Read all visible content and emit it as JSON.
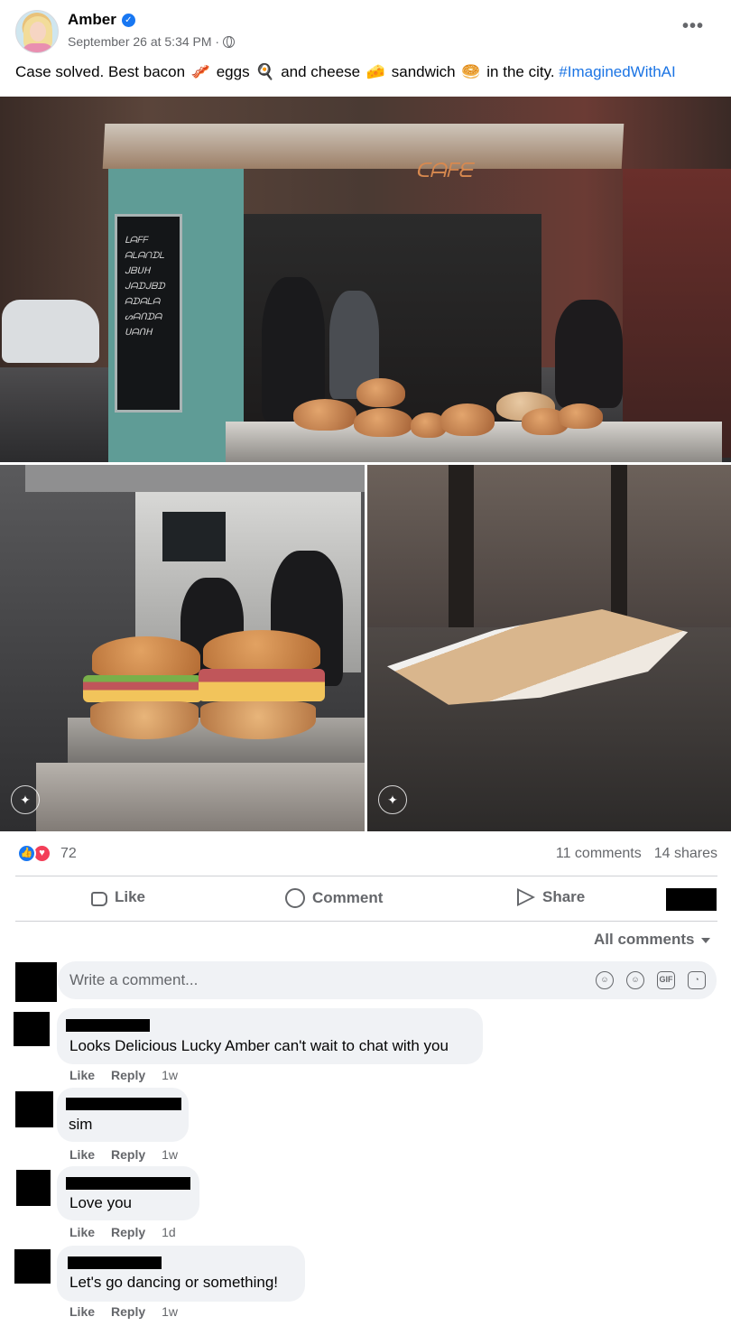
{
  "post": {
    "author": "Amber",
    "timestamp": "September 26 at 5:34 PM ·",
    "caption_parts": {
      "t1": "Case solved. Best bacon",
      "e1": "🥓",
      "t2": "eggs",
      "e2": "🍳",
      "t3": "and cheese",
      "e3": "🧀",
      "t4": "sandwich",
      "e4": "🥯",
      "t5": "in the city.",
      "hashtag": "#ImaginedWithAI"
    }
  },
  "photos": {
    "board_text": [
      "ᒪᗩᖴᖴ",
      "ᗩᒪᗩᑎᗪᒪ",
      "ᒍᗷᑌᕼ",
      "ᒍᗩᗪᒍᗷᗪ",
      "ᗩᗪᗩᒪᗩ",
      "ᔕᗩᑎᗪᗩ",
      "ᑌᗩᑎᕼ"
    ],
    "roof_sign": "ᑕᗩᖴᗴ"
  },
  "stats": {
    "reaction_count": "72",
    "comments": "11 comments",
    "shares": "14 shares"
  },
  "actions": {
    "like": "Like",
    "comment": "Comment",
    "share": "Share"
  },
  "comments_filter": "All comments",
  "composer": {
    "placeholder": "Write a comment..."
  },
  "comments": [
    {
      "text": "Looks Delicious Lucky Amber can't wait to chat with you",
      "like": "Like",
      "reply": "Reply",
      "time": "1w"
    },
    {
      "text": "sim",
      "like": "Like",
      "reply": "Reply",
      "time": "1w"
    },
    {
      "text": "Love you",
      "like": "Like",
      "reply": "Reply",
      "time": "1d"
    },
    {
      "text": "Let's go dancing or something!",
      "like": "Like",
      "reply": "Reply",
      "time": "1w"
    }
  ],
  "colors": {
    "link": "#1b74e4",
    "like_blue": "#1877f2",
    "love_red": "#f33e58",
    "secondary_text": "#65676b",
    "bubble_bg": "#f0f2f5"
  }
}
